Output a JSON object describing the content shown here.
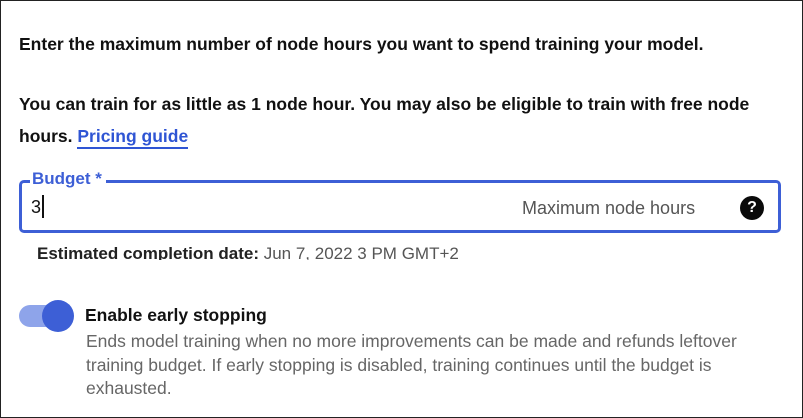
{
  "intro": {
    "line1": "Enter the maximum number of node hours you want to spend training your model.",
    "line2": "You can train for as little as 1 node hour. You may also be eligible to train with free node hours.",
    "link_label": "Pricing guide"
  },
  "budget": {
    "label": "Budget *",
    "value": "3",
    "suffix": "Maximum node hours",
    "help_glyph": "?",
    "estimate_label": "Estimated completion date:",
    "estimate_value": "Jun 7, 2022 3 PM GMT+2"
  },
  "early_stopping": {
    "title": "Enable early stopping",
    "enabled": true,
    "description": "Ends model training when no more improvements can be made and refunds leftover training budget. If early stopping is disabled, training continues until the budget is exhausted."
  },
  "colors": {
    "accent": "#3d5fd6",
    "link": "#2f55d4",
    "toggle_track": "#8ea4ea"
  }
}
